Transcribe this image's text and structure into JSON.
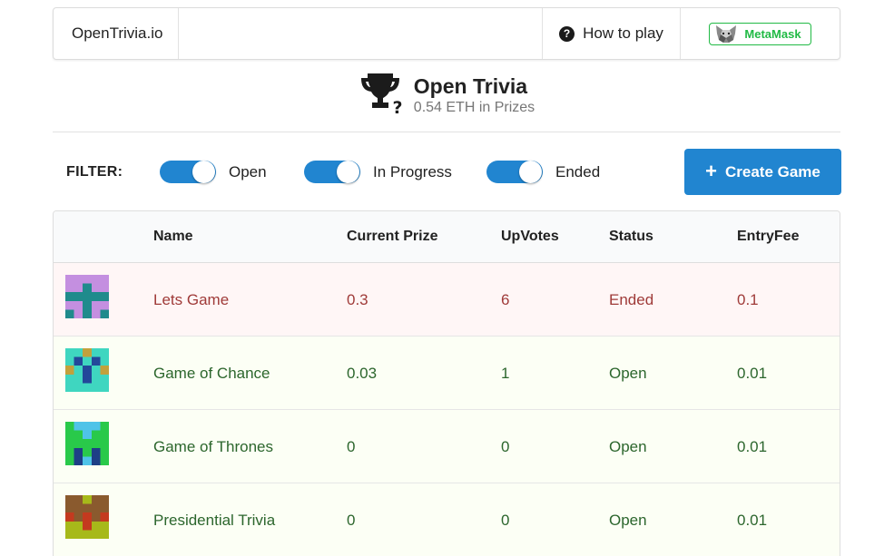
{
  "nav": {
    "brand": "OpenTrivia.io",
    "help_icon": "question-circle-icon",
    "how_to_play": "How to play",
    "metamask_icon": "metamask-fox-icon",
    "metamask_label": "MetaMask"
  },
  "header": {
    "trophy_icon": "trophy-question-icon",
    "title": "Open Trivia",
    "subtitle": "0.54 ETH in Prizes"
  },
  "filter": {
    "label": "FILTER:",
    "toggles": [
      {
        "label": "Open",
        "on": true
      },
      {
        "label": "In Progress",
        "on": true
      },
      {
        "label": "Ended",
        "on": true
      }
    ],
    "create_icon": "plus-icon",
    "create_label": "Create Game"
  },
  "table": {
    "columns": [
      "Name",
      "Current Prize",
      "UpVotes",
      "Status",
      "EntryFee"
    ],
    "rows": [
      {
        "name": "Lets Game",
        "prize": "0.3",
        "upvotes": "6",
        "status": "Ended",
        "fee": "0.1"
      },
      {
        "name": "Game of Chance",
        "prize": "0.03",
        "upvotes": "1",
        "status": "Open",
        "fee": "0.01"
      },
      {
        "name": "Game of Thrones",
        "prize": "0",
        "upvotes": "0",
        "status": "Open",
        "fee": "0.01"
      },
      {
        "name": "Presidential Trivia",
        "prize": "0",
        "upvotes": "0",
        "status": "Open",
        "fee": "0.01"
      }
    ]
  },
  "colors": {
    "primary": "#2185d0",
    "metamask_green": "#21ba45",
    "ended_text": "#9f3a38",
    "ended_bg": "#fff6f6",
    "open_text": "#2c662d",
    "open_bg": "#fcfff5"
  }
}
